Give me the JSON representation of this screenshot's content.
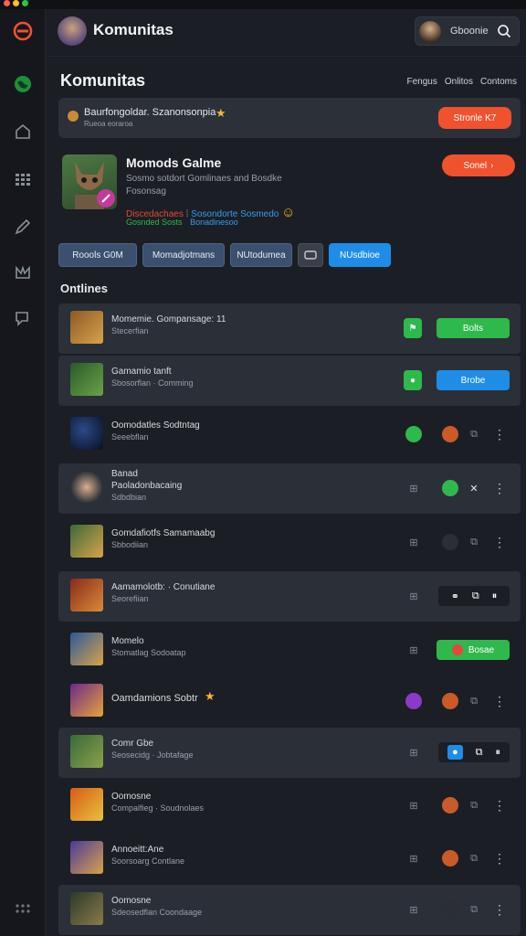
{
  "header": {
    "title": "Komunitas",
    "user_name": "Gboonie"
  },
  "main": {
    "page_title": "Komunitas",
    "tabs": [
      "Fengus",
      "Onlitos",
      "Contoms"
    ],
    "notice": {
      "text": "Baurfongoldar. Szanonsonpia",
      "sub": "Rueoa eoraroa",
      "button": "Stronle K7"
    },
    "profile": {
      "name": "Momods Galme",
      "desc_line1": "Sosmo sotdort Gomlinaes and Bosdke",
      "desc_line2": "Fosonsag",
      "tag_red": "Discedachaes",
      "tag_blue": "Sosondorte Sosmedo",
      "tag_green1": "Gosnded Sosts",
      "tag_blue2": "Bonadinesoo",
      "button": "Sonel"
    },
    "pills": [
      "Roools G0M",
      "Momadjotmans",
      "NUtodumea",
      "",
      "NUsdbioe"
    ],
    "section_title": "Ontlines",
    "rows": [
      {
        "t1": "Momemie. Gompansage: 11",
        "t2": "Stecerfian",
        "action": "Bolts"
      },
      {
        "t1": "Gamamio tanft",
        "t2": "Sbosorflan  · Comming",
        "action": "Brobe"
      },
      {
        "t1": "Oomodatles  Sodtntag",
        "t2": "Seeebflan",
        "action": ""
      },
      {
        "t1": "Banad",
        "t2": "Paoladonbacaing",
        "t3": "Sdbdbian",
        "action": ""
      },
      {
        "t1": "Gomdafiotfs  Samamaabg",
        "t2": "Sbbodiian",
        "action": ""
      },
      {
        "t1": "Aamamolotb:  · Conutiane",
        "t2": "Seorefiian",
        "action": ""
      },
      {
        "t1": "Momelo",
        "t2": "Stomatlag  Sodoatap",
        "action": "Bosae"
      },
      {
        "t1": "Oamdamions  Sobtr",
        "t2": "",
        "action": ""
      },
      {
        "t1": "Comr Gbe",
        "t2": "Seosecidg  · Jobtafage",
        "action": ""
      },
      {
        "t1": "Oomosne",
        "t2": "Compalfieg  · Soudnolaes",
        "action": ""
      },
      {
        "t1": "Annoeitt:Ane",
        "t2": "Soorsoarg  Contlane",
        "action": ""
      },
      {
        "t1": "Oomosne",
        "t2": "Sdeosedflan  Coondaage",
        "action": ""
      }
    ]
  },
  "colors": {
    "accent_orange": "#f0522d",
    "accent_blue": "#1f8de8",
    "accent_green": "#2fb84c"
  }
}
